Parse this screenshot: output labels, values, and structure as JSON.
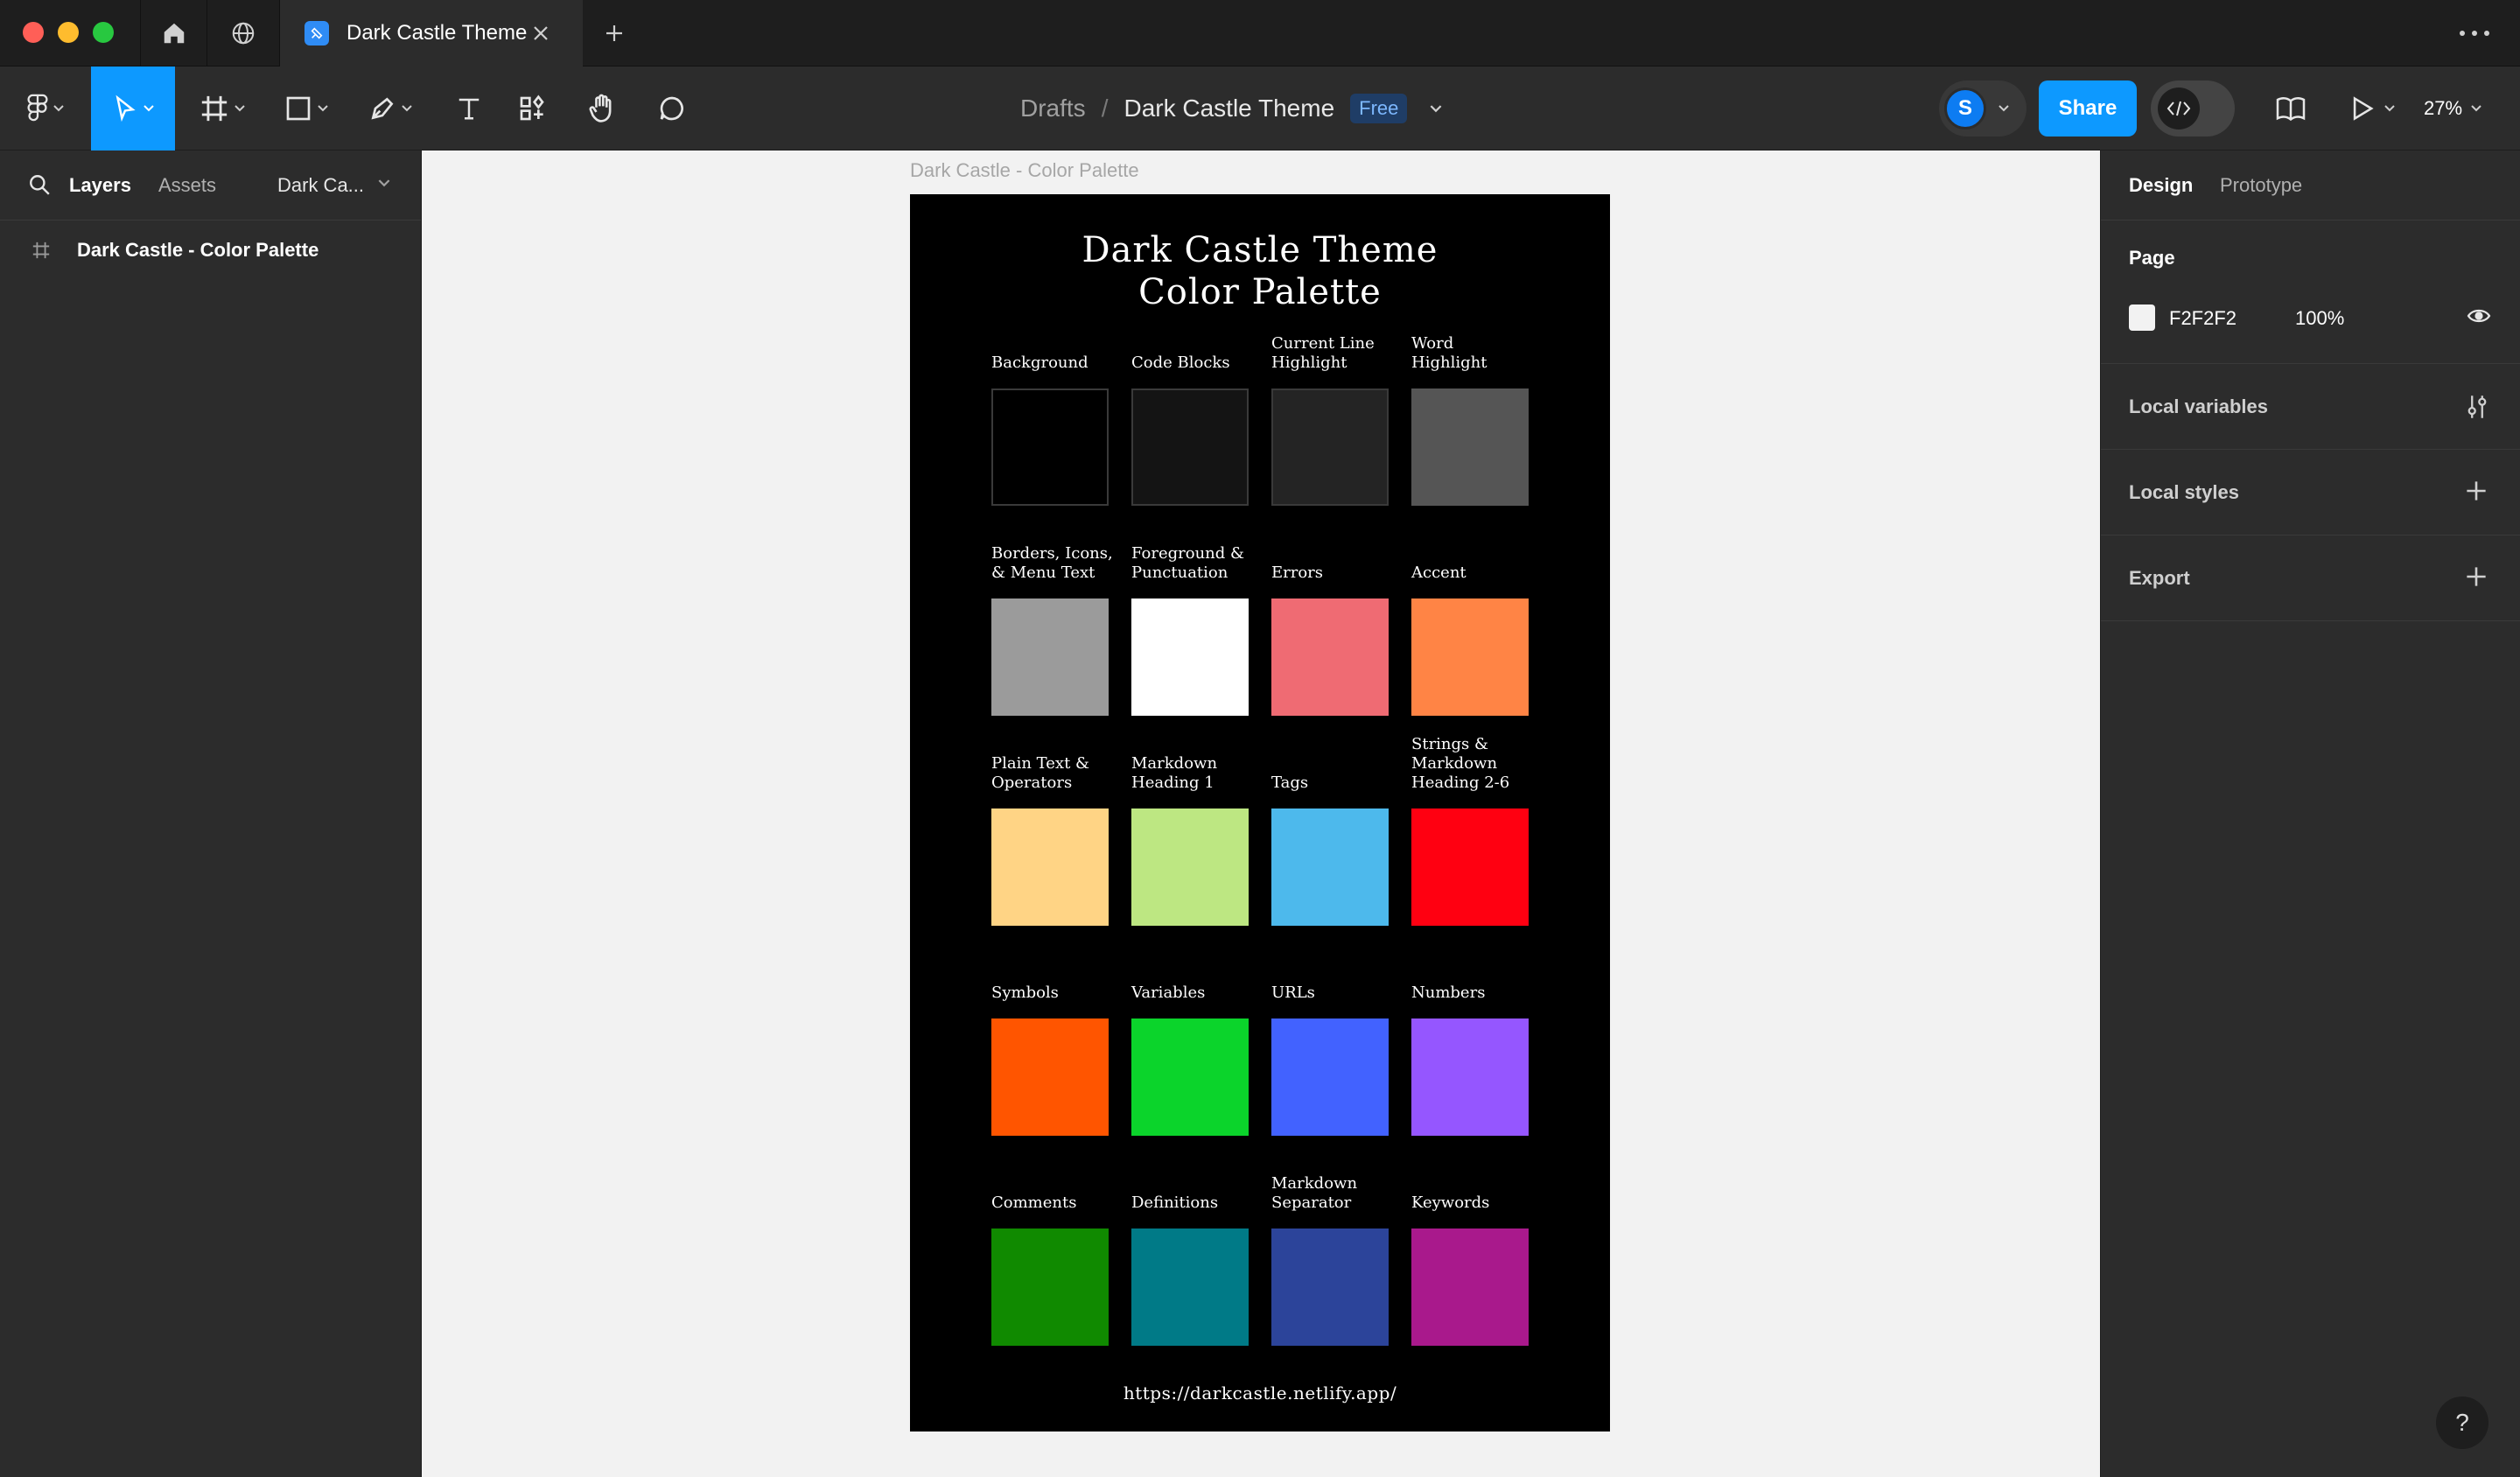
{
  "tab": {
    "title": "Dark Castle Theme"
  },
  "breadcrumb": {
    "parent": "Drafts",
    "separator": "/",
    "file": "Dark Castle Theme",
    "plan_badge": "Free"
  },
  "user": {
    "initial": "S"
  },
  "toolbar": {
    "share_label": "Share",
    "zoom": "27%"
  },
  "left_panel": {
    "tabs": [
      "Layers",
      "Assets"
    ],
    "page_name": "Dark Ca...",
    "layers": [
      {
        "name": "Dark Castle - Color Palette",
        "type": "frame"
      }
    ]
  },
  "canvas": {
    "background": "#F2F2F2",
    "frame_label": "Dark Castle - Color Palette",
    "frame": {
      "title_line1": "Dark Castle Theme",
      "title_line2": "Color Palette",
      "url": "https://darkcastle.netlify.app/",
      "swatches": [
        {
          "label": "Background",
          "color": "#000000"
        },
        {
          "label": "Code Blocks",
          "color": "#141414"
        },
        {
          "label": "Current Line Highlight",
          "color": "#242424"
        },
        {
          "label": "Word Highlight",
          "color": "#555555"
        },
        {
          "label": "Borders, Icons, & Menu Text",
          "color": "#9B9B9B"
        },
        {
          "label": "Foreground & Punctuation",
          "color": "#FFFFFF"
        },
        {
          "label": "Errors",
          "color": "#EF6B73"
        },
        {
          "label": "Accent",
          "color": "#FF8445"
        },
        {
          "label": "Plain Text & Operators",
          "color": "#FFD485"
        },
        {
          "label": "Markdown Heading 1",
          "color": "#BDE782"
        },
        {
          "label": "Tags",
          "color": "#4DB9EC"
        },
        {
          "label": "Strings & Markdown Heading 2-6",
          "color": "#FF0011"
        },
        {
          "label": "Symbols",
          "color": "#FF5500"
        },
        {
          "label": "Variables",
          "color": "#0BD42B"
        },
        {
          "label": "URLs",
          "color": "#4262FF"
        },
        {
          "label": "Numbers",
          "color": "#9556FF"
        },
        {
          "label": "Comments",
          "color": "#108A00"
        },
        {
          "label": "Definitions",
          "color": "#007A87"
        },
        {
          "label": "Markdown Separator",
          "color": "#2C449A"
        },
        {
          "label": "Keywords",
          "color": "#A9198C"
        }
      ]
    }
  },
  "right_panel": {
    "tabs": [
      "Design",
      "Prototype"
    ],
    "page_section": {
      "title": "Page",
      "color_hex": "F2F2F2",
      "opacity": "100%"
    },
    "sections": [
      "Local variables",
      "Local styles",
      "Export"
    ]
  },
  "help_label": "?",
  "colors": {
    "accent": "#0D99FF",
    "panel": "#2C2C2C",
    "titlebar": "#1E1E1E"
  }
}
